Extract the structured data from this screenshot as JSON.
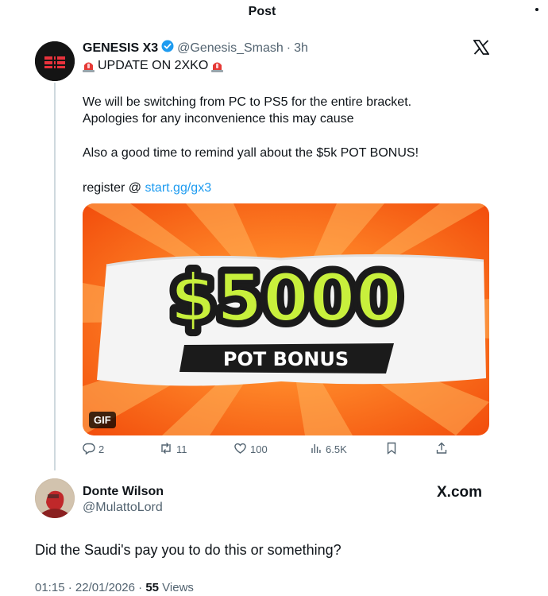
{
  "header": {
    "title": "Post"
  },
  "post": {
    "author_name": "GENESIS X3",
    "author_handle": "@Genesis_Smash",
    "separator": "·",
    "time": "3h",
    "title_line": "UPDATE ON 2XKO",
    "body_line1": "We will be switching from PC to PS5 for the entire bracket.",
    "body_line2": "Apologies for any inconvenience this may cause",
    "body_line3": "Also a good time to remind yall about the $5k POT BONUS!",
    "register_prefix": "register @ ",
    "register_link": "start.gg/gx3",
    "media": {
      "big_text": "$5000",
      "sub_text": "POT BONUS",
      "badge": "GIF",
      "colors": {
        "orange": "#ff5a12",
        "lime": "#c8f03c"
      }
    },
    "actions": {
      "replies": "2",
      "reposts": "11",
      "likes": "100",
      "views": "6.5K"
    }
  },
  "reply": {
    "author_name": "Donte Wilson",
    "author_handle": "@MulattoLord",
    "watermark": "X.com",
    "text": "Did the Saudi's pay you to do this or something?",
    "time": "01:15",
    "sep1": "·",
    "date": "22/01/2026",
    "sep2": "·",
    "views": "55",
    "views_label": "Views"
  },
  "colors": {
    "accent": "#1d9bf0",
    "verified": "#1d9bf0",
    "muted": "#536471"
  }
}
